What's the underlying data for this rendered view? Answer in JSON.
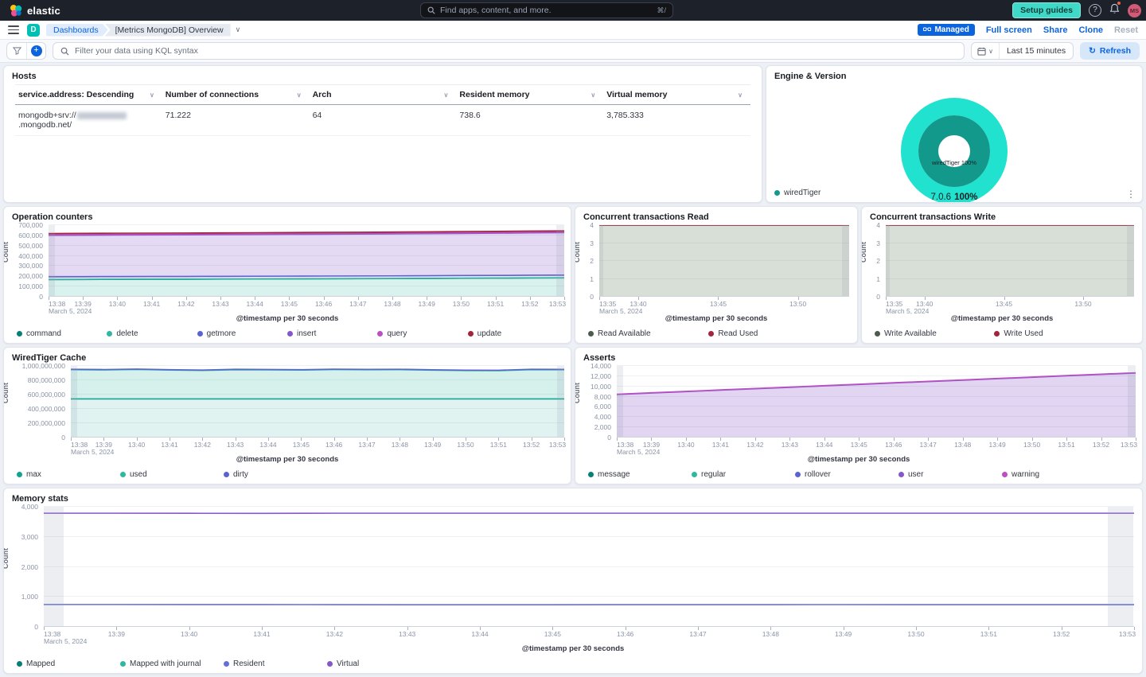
{
  "header": {
    "brand": "elastic",
    "search": {
      "placeholder": "Find apps, content, and more.",
      "shortcut": "⌘/"
    },
    "setup_guides_label": "Setup guides",
    "help_glyph": "?",
    "avatar_initials": "MS"
  },
  "navbar": {
    "app_badge": "D",
    "breadcrumbs": [
      "Dashboards",
      "[Metrics MongoDB] Overview"
    ],
    "managed_label": "Managed",
    "actions": {
      "full_screen": "Full screen",
      "share": "Share",
      "clone": "Clone",
      "reset": "Reset"
    }
  },
  "filter_bar": {
    "kql_placeholder": "Filter your data using KQL syntax",
    "time_range": "Last 15 minutes",
    "refresh_label": "Refresh"
  },
  "hosts_panel": {
    "title": "Hosts",
    "columns": [
      "service.address: Descending",
      "Number of connections",
      "Arch",
      "Resident memory",
      "Virtual memory"
    ],
    "row": {
      "address_prefix": "mongodb+srv://",
      "address_suffix": ".mongodb.net/",
      "connections": "71.222",
      "arch": "64",
      "resident_memory": "738.6",
      "virtual_memory": "3,785.333"
    }
  },
  "engine_panel": {
    "title": "Engine & Version",
    "inner_label": "wiredTiger 100%",
    "outer_label_version": "7.0.6",
    "outer_label_pct": "100%",
    "colors": {
      "outer_ring": "#20e2cf",
      "inner_ring": "#13998b"
    },
    "legend": [
      {
        "label": "wiredTiger",
        "color": "#13998b"
      }
    ]
  },
  "chart_data": {
    "op": {
      "type": "area",
      "stacked": true,
      "title": "Operation counters",
      "ylabel": "Count",
      "xlabel": "@timestamp per 30 seconds",
      "ylim": [
        0,
        700000
      ],
      "yticks": [
        {
          "v": 0,
          "label": "0"
        },
        {
          "v": 100000,
          "label": "100,000"
        },
        {
          "v": 200000,
          "label": "200,000"
        },
        {
          "v": 300000,
          "label": "300,000"
        },
        {
          "v": 400000,
          "label": "400,000"
        },
        {
          "v": 500000,
          "label": "500,000"
        },
        {
          "v": 600000,
          "label": "600,000"
        },
        {
          "v": 700000,
          "label": "700,000"
        }
      ],
      "x_labels": [
        "13:38",
        "13:39",
        "13:40",
        "13:41",
        "13:42",
        "13:43",
        "13:44",
        "13:45",
        "13:46",
        "13:47",
        "13:48",
        "13:49",
        "13:50",
        "13:51",
        "13:52",
        "13:53"
      ],
      "x_date_label": "March 5, 2024",
      "bands": [
        {
          "x0": 0,
          "x1": 0.013
        },
        {
          "x0": 0.985,
          "x1": 1
        }
      ],
      "series": [
        {
          "name": "command",
          "color": "#067f74",
          "fill": "rgba(48,184,158,0.18)",
          "values": [
            168000,
            169000,
            170000,
            170500,
            171000,
            172000,
            173000,
            174000,
            175000,
            176000,
            177000,
            178500,
            180000,
            181000,
            183000,
            184000
          ]
        },
        {
          "name": "delete",
          "color": "#30b89e",
          "fill": "rgba(48,184,158,0.2)",
          "values": [
            1200,
            1200,
            1200,
            1200,
            1200,
            1200,
            1200,
            1200,
            1200,
            1200,
            1200,
            1200,
            1200,
            1200,
            1200,
            1200
          ]
        },
        {
          "name": "getmore",
          "color": "#5a63cf",
          "fill": "rgba(90,99,207,0.14)",
          "values": [
            26000,
            26000,
            26000,
            26000,
            26000,
            26000,
            26000,
            26000,
            26000,
            26000,
            26000,
            26000,
            26000,
            26000,
            26000,
            26000
          ]
        },
        {
          "name": "insert",
          "color": "#8657c9",
          "fill": "rgba(134,87,201,0.22)",
          "values": [
            405000,
            405500,
            406000,
            406500,
            407000,
            407500,
            408000,
            408500,
            409000,
            409500,
            410500,
            411000,
            412000,
            413000,
            414000,
            415000
          ]
        },
        {
          "name": "query",
          "color": "#bc4fc4",
          "fill": "rgba(188,79,196,0.15)",
          "values": [
            6000,
            6000,
            6000,
            6000,
            6000,
            6000,
            6000,
            6000,
            6000,
            6000,
            6000,
            6000,
            6000,
            6000,
            6000,
            6000
          ]
        },
        {
          "name": "update",
          "color": "#a1253c",
          "fill": "rgba(161,37,60,0.12)",
          "values": [
            12000,
            12000,
            12000,
            12000,
            12000,
            12000,
            12000,
            12000,
            12000,
            12000,
            12000,
            12000,
            12000,
            12000,
            12000,
            12000
          ]
        }
      ]
    },
    "read": {
      "type": "area",
      "stacked": true,
      "title": "Concurrent transactions Read",
      "ylabel": "Count",
      "xlabel": "@timestamp per 30 seconds",
      "ylim": [
        0,
        4
      ],
      "yticks": [
        {
          "v": 0,
          "label": "0"
        },
        {
          "v": 1,
          "label": "1"
        },
        {
          "v": 2,
          "label": "2"
        },
        {
          "v": 3,
          "label": "3"
        },
        {
          "v": 4,
          "label": "4"
        }
      ],
      "x_labels": [
        "13:35",
        "13:40",
        "13:45",
        "13:50"
      ],
      "x_tick_fractions": [
        0,
        0.156,
        0.476,
        0.795
      ],
      "x_date_label": "March 5, 2024",
      "bands": [
        {
          "x0": 0,
          "x1": 0.016
        },
        {
          "x0": 0.972,
          "x1": 1
        }
      ],
      "series": [
        {
          "name": "Read Available",
          "color": "#4d5a4e",
          "fill": "rgba(125,150,120,0.3)",
          "values": [
            4,
            4,
            4,
            4,
            4,
            4,
            4,
            4,
            4,
            4,
            4,
            4,
            4,
            4,
            4,
            4
          ]
        },
        {
          "name": "Read Used",
          "color": "#a1253c",
          "fill": "rgba(161,37,60,0.1)",
          "values": [
            0,
            0,
            0,
            0,
            0,
            0,
            0,
            0,
            0,
            0,
            0,
            0,
            0,
            0,
            0,
            0
          ]
        }
      ]
    },
    "write": {
      "type": "area",
      "stacked": true,
      "title": "Concurrent transactions Write",
      "ylabel": "Count",
      "xlabel": "@timestamp per 30 seconds",
      "ylim": [
        0,
        4
      ],
      "yticks": [
        {
          "v": 0,
          "label": "0"
        },
        {
          "v": 1,
          "label": "1"
        },
        {
          "v": 2,
          "label": "2"
        },
        {
          "v": 3,
          "label": "3"
        },
        {
          "v": 4,
          "label": "4"
        }
      ],
      "x_labels": [
        "13:35",
        "13:40",
        "13:45",
        "13:50"
      ],
      "x_tick_fractions": [
        0,
        0.156,
        0.476,
        0.795
      ],
      "x_date_label": "March 5, 2024",
      "bands": [
        {
          "x0": 0,
          "x1": 0.016
        },
        {
          "x0": 0.972,
          "x1": 1
        }
      ],
      "series": [
        {
          "name": "Write Available",
          "color": "#4d5a4e",
          "fill": "rgba(125,150,120,0.3)",
          "values": [
            4,
            4,
            4,
            4,
            4,
            4,
            4,
            4,
            4,
            4,
            4,
            4,
            4,
            4,
            4,
            4
          ]
        },
        {
          "name": "Write Used",
          "color": "#a1253c",
          "fill": "rgba(161,37,60,0.1)",
          "values": [
            0,
            0,
            0,
            0,
            0,
            0,
            0,
            0,
            0,
            0,
            0,
            0,
            0,
            0,
            0,
            0
          ]
        }
      ]
    },
    "wt": {
      "type": "area",
      "stacked": true,
      "title": "WiredTiger Cache",
      "ylabel": "Count",
      "xlabel": "@timestamp per 30 seconds",
      "ylim": [
        0,
        1000000000
      ],
      "yticks": [
        {
          "v": 0,
          "label": "0"
        },
        {
          "v": 200000000,
          "label": "200,000,000"
        },
        {
          "v": 400000000,
          "label": "400,000,000"
        },
        {
          "v": 600000000,
          "label": "600,000,000"
        },
        {
          "v": 800000000,
          "label": "800,000,000"
        },
        {
          "v": 1000000000,
          "label": "1,000,000,000"
        }
      ],
      "x_labels": [
        "13:38",
        "13:39",
        "13:40",
        "13:41",
        "13:42",
        "13:43",
        "13:44",
        "13:45",
        "13:46",
        "13:47",
        "13:48",
        "13:49",
        "13:50",
        "13:51",
        "13:52",
        "13:53"
      ],
      "x_date_label": "March 5, 2024",
      "bands": [
        {
          "x0": 0,
          "x1": 0.013
        },
        {
          "x0": 0.985,
          "x1": 1
        }
      ],
      "series": [
        {
          "name": "max",
          "color": "#13a392",
          "fill": "rgba(19,163,146,0.13)",
          "values": [
            540000000,
            540000000,
            540000000,
            540000000,
            540000000,
            540000000,
            540000000,
            540000000,
            540000000,
            540000000,
            540000000,
            540000000,
            540000000,
            540000000,
            540000000,
            540000000
          ]
        },
        {
          "name": "used",
          "color": "#30b89e",
          "fill": "rgba(48,184,158,0.2)",
          "values": [
            408000000,
            404000000,
            410000000,
            402000000,
            396000000,
            407000000,
            405000000,
            402000000,
            409000000,
            406000000,
            408000000,
            401000000,
            395000000,
            394000000,
            408000000,
            406000000
          ]
        },
        {
          "name": "dirty",
          "color": "#5a63cf",
          "fill": "rgba(90,99,207,0.12)",
          "values": [
            6000000,
            6000000,
            6000000,
            6000000,
            6000000,
            6000000,
            6000000,
            6000000,
            6000000,
            6000000,
            6000000,
            6000000,
            6000000,
            6000000,
            6000000,
            6000000
          ]
        }
      ]
    },
    "asserts": {
      "type": "area",
      "stacked": true,
      "title": "Asserts",
      "ylabel": "Count",
      "xlabel": "@timestamp per 30 seconds",
      "ylim": [
        0,
        14000
      ],
      "yticks": [
        {
          "v": 0,
          "label": "0"
        },
        {
          "v": 2000,
          "label": "2,000"
        },
        {
          "v": 4000,
          "label": "4,000"
        },
        {
          "v": 6000,
          "label": "6,000"
        },
        {
          "v": 8000,
          "label": "8,000"
        },
        {
          "v": 10000,
          "label": "10,000"
        },
        {
          "v": 12000,
          "label": "12,000"
        },
        {
          "v": 14000,
          "label": "14,000"
        }
      ],
      "x_labels": [
        "13:38",
        "13:39",
        "13:40",
        "13:41",
        "13:42",
        "13:43",
        "13:44",
        "13:45",
        "13:46",
        "13:47",
        "13:48",
        "13:49",
        "13:50",
        "13:51",
        "13:52",
        "13:53"
      ],
      "x_date_label": "March 5, 2024",
      "bands": [
        {
          "x0": 0,
          "x1": 0.013
        },
        {
          "x0": 0.985,
          "x1": 1
        }
      ],
      "series": [
        {
          "name": "message",
          "color": "#067f74",
          "fill": "rgba(6,127,116,0.15)",
          "values": [
            4,
            4,
            4,
            4,
            4,
            4,
            4,
            4,
            4,
            4,
            4,
            4,
            4,
            4,
            4,
            4
          ]
        },
        {
          "name": "regular",
          "color": "#30b89e",
          "fill": "rgba(48,184,158,0.15)",
          "values": [
            4,
            4,
            4,
            4,
            4,
            4,
            4,
            4,
            4,
            4,
            4,
            4,
            4,
            4,
            4,
            4
          ]
        },
        {
          "name": "rollover",
          "color": "#5a63cf",
          "fill": "rgba(90,99,207,0.12)",
          "values": [
            8,
            8,
            8,
            8,
            8,
            8,
            8,
            8,
            8,
            8,
            8,
            8,
            8,
            8,
            8,
            8
          ]
        },
        {
          "name": "user",
          "color": "#8657c9",
          "fill": "rgba(134,87,201,0.25)",
          "values": [
            8400,
            8680,
            8960,
            9240,
            9520,
            9800,
            10080,
            10360,
            10640,
            10920,
            11200,
            11480,
            11760,
            12040,
            12320,
            12600
          ]
        },
        {
          "name": "warning",
          "color": "#bc4fc4",
          "fill": "rgba(188,79,196,0.2)",
          "values": [
            60,
            60,
            60,
            60,
            60,
            60,
            60,
            60,
            60,
            60,
            60,
            60,
            60,
            60,
            60,
            60
          ]
        }
      ]
    },
    "memory": {
      "type": "line",
      "stacked": false,
      "title": "Memory stats",
      "ylabel": "Count",
      "xlabel": "@timestamp per 30 seconds",
      "ylim": [
        0,
        4000
      ],
      "yticks": [
        {
          "v": 0,
          "label": "0"
        },
        {
          "v": 1000,
          "label": "1,000"
        },
        {
          "v": 2000,
          "label": "2,000"
        },
        {
          "v": 3000,
          "label": "3,000"
        },
        {
          "v": 4000,
          "label": "4,000"
        }
      ],
      "x_labels": [
        "13:38",
        "13:39",
        "13:40",
        "13:41",
        "13:42",
        "13:43",
        "13:44",
        "13:45",
        "13:46",
        "13:47",
        "13:48",
        "13:49",
        "13:50",
        "13:51",
        "13:52",
        "13:53"
      ],
      "x_date_label": "March 5, 2024",
      "bands": [
        {
          "x0": 0,
          "x1": 0.018
        },
        {
          "x0": 0.976,
          "x1": 0.999
        }
      ],
      "series": [
        {
          "name": "Mapped",
          "color": "#067f74",
          "fill": null,
          "values": null
        },
        {
          "name": "Mapped with journal",
          "color": "#30b89e",
          "fill": null,
          "values": null
        },
        {
          "name": "Resident",
          "color": "#6470d6",
          "fill": null,
          "values": [
            745,
            745,
            744,
            743,
            741,
            737,
            736,
            738,
            740,
            741,
            741,
            742,
            741,
            741,
            741,
            741
          ]
        },
        {
          "name": "Virtual",
          "color": "#8657c9",
          "fill": null,
          "values": [
            3785,
            3785,
            3782,
            3780,
            3785,
            3785,
            3785,
            3785,
            3785,
            3785,
            3785,
            3785,
            3785,
            3785,
            3785,
            3785
          ]
        }
      ]
    }
  }
}
